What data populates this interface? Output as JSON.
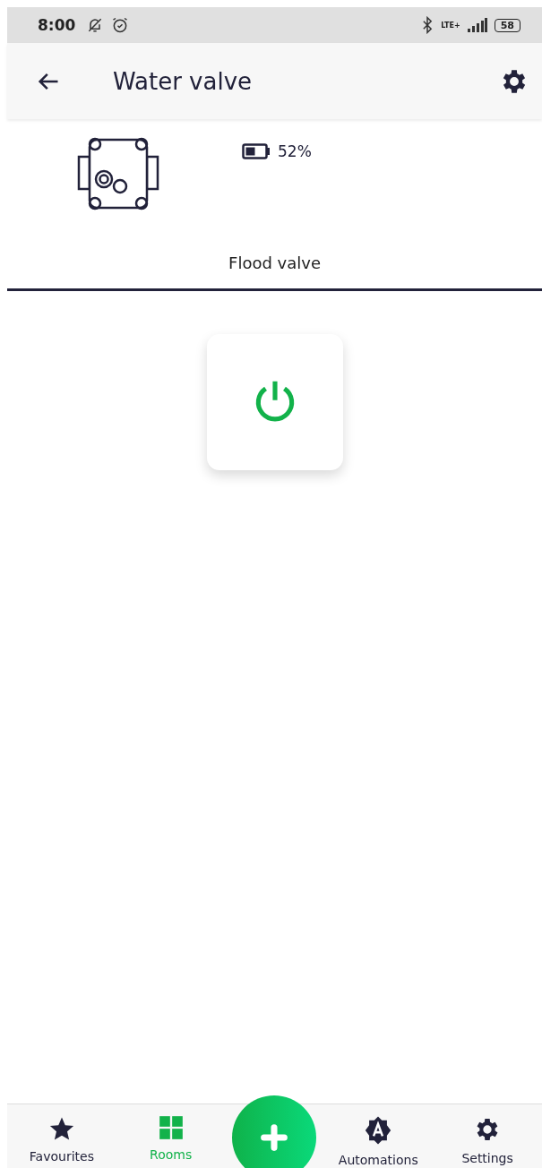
{
  "status_bar": {
    "time": "8:00",
    "network": "LTE+",
    "battery": "58"
  },
  "app_bar": {
    "title": "Water valve"
  },
  "device": {
    "battery_reading": "52%",
    "name": "Flood valve"
  },
  "power": {
    "on": true
  },
  "nav": [
    {
      "label": "Favourites",
      "kind": "star",
      "selected": false
    },
    {
      "label": "Rooms",
      "kind": "grid",
      "selected": true
    },
    {
      "kind": "add",
      "selected": false
    },
    {
      "label": "Automations",
      "kind": "auto",
      "selected": false
    },
    {
      "label": "Settings",
      "kind": "gear",
      "selected": false
    }
  ]
}
